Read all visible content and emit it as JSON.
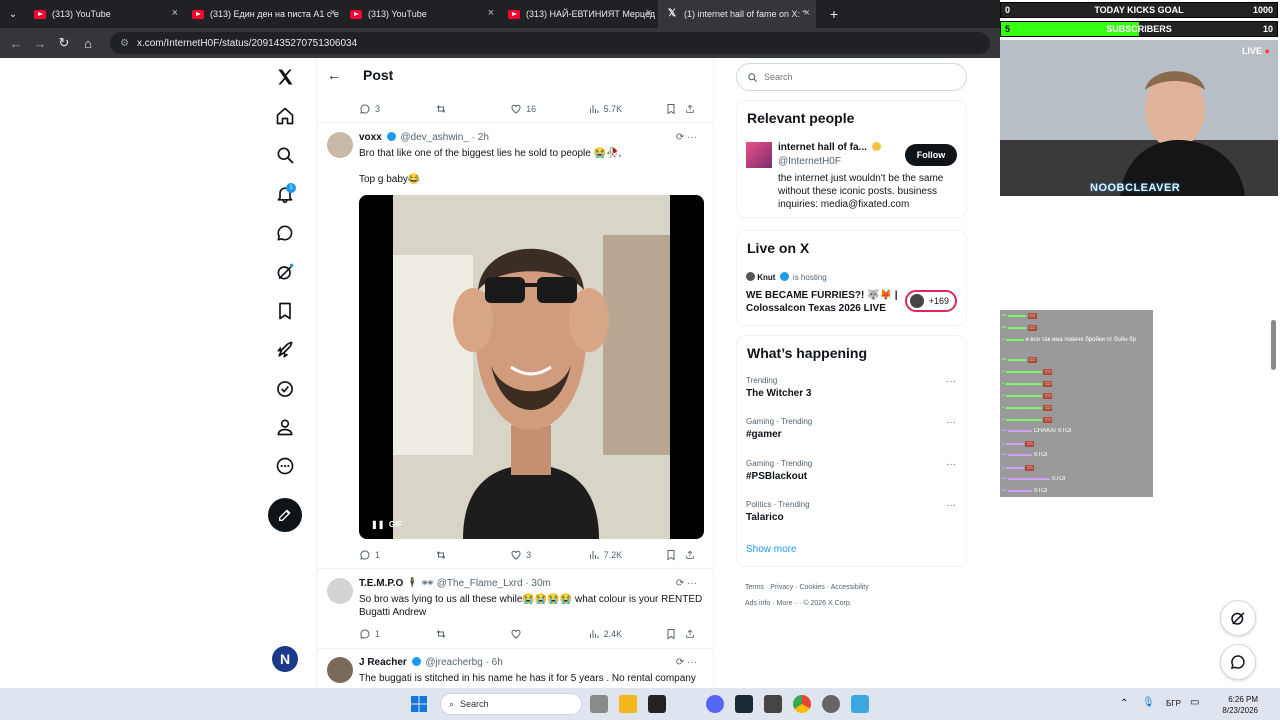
{
  "browser": {
    "tabs": [
      {
        "label": "(313) YouTube"
      },
      {
        "label": "(313) Един ден на писта А1 с е"
      },
      {
        "label": "(313) YouTube"
      },
      {
        "label": "(313) НАЙ-ЕВТИНИЯТ Мерцед"
      },
      {
        "label": "(1) internet hall of fame on X: \""
      }
    ],
    "url": "x.com/InternetH0F/status/2091435270751306034",
    "new_tab": "+",
    "close": "×"
  },
  "nav": {
    "notifications_badge": "1"
  },
  "post": {
    "header_title": "Post",
    "top_actions": {
      "replies": "3",
      "likes": "16",
      "views": "5.7K"
    },
    "replies": [
      {
        "name": "voxx",
        "handle": "@dev_ashwin_",
        "time": "· 2h",
        "text_line1": "Bro that like one of the biggest lies he sold to people 😭🥀,",
        "text_line2": "Top g baby😂",
        "gif_label": "GIF",
        "actions": {
          "replies": "1",
          "likes": "3",
          "views": "7.2K"
        }
      },
      {
        "name": "T.E.M.P.O",
        "handle": "@The_Flame_Lxrd",
        "extra": "🕴 🕶",
        "time": "· 30m",
        "text": "So bro was lying to us all these while😭😭😭😭 what colour is your RENTED Bugatti Andrew",
        "actions": {
          "replies": "1",
          "likes": "",
          "views": "2.4K"
        }
      },
      {
        "name": "J Reacher",
        "handle": "@jreacherbg",
        "time": "· 6h",
        "text": "The buggati is stitched in his name he has it for 5 years . No rental company"
      }
    ]
  },
  "sidebar": {
    "search_placeholder": "Search",
    "relevant": {
      "title": "Relevant people",
      "name": "internet hall of fa...",
      "handle": "@InternetH0F",
      "bio": "the internet just wouldn't be the same without these iconic posts. business inquiries: media@fixated.com",
      "follow_label": "Follow"
    },
    "live": {
      "title": "Live on X",
      "host": "Knut",
      "hosting": "is hosting",
      "stream_title": "WE BECAME FURRIES?! 🐺🦊 | Colossalcon Texas 2026  LIVE",
      "listeners": "+169"
    },
    "happening": {
      "title": "What’s happening",
      "trends": [
        {
          "category": "Trending",
          "name": "The Witcher 3"
        },
        {
          "category": "Gaming · Trending",
          "name": "#gamer"
        },
        {
          "category": "Gaming · Trending",
          "name": "#PSBlackout"
        },
        {
          "category": "Politics · Trending",
          "name": "Talarico"
        }
      ],
      "show_more": "Show more"
    },
    "footer": {
      "line1": [
        "Terms",
        "Privacy",
        "Cookies",
        "Accessibility"
      ],
      "line2": [
        "Ads info",
        "More ···",
        "© 2026 X Corp."
      ]
    }
  },
  "overlay": {
    "goal1": {
      "left": "0",
      "label": "TODAY KICKS GOAL",
      "right": "1000"
    },
    "goal2": {
      "left": "5",
      "label": "SUBSCRIBERS",
      "right": "10",
      "progress": 0.5
    },
    "live_label": "LIVE",
    "streamer": "NOOBCLEAVER",
    "chat_snippets": [
      "и все так има повече бройки от бойн бр",
      "CHAKAI STOI",
      "STOI",
      "STOI",
      "STOI"
    ]
  },
  "taskbar": {
    "search_label": "Search",
    "lang": "БГР",
    "time": "6:26 PM",
    "date": "8/23/2026"
  },
  "colors": {
    "x_blue": "#1d9bf0",
    "text": "#0f1419",
    "muted": "#536471",
    "goal_green": "#39ff14"
  }
}
